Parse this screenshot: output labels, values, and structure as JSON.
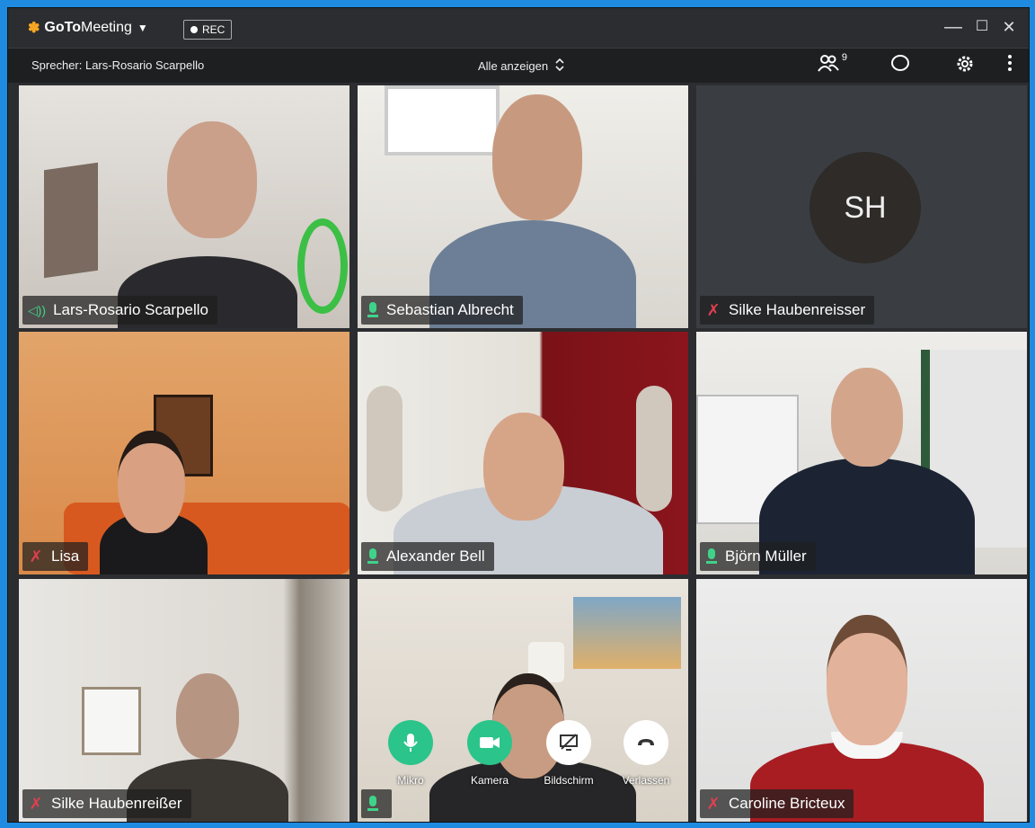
{
  "app": {
    "logo_mark": "✽",
    "logo_bold": "GoTo",
    "logo_light": "Meeting",
    "logo_caret": "▼",
    "rec_label": "REC"
  },
  "window_controls": {
    "minimize": "—",
    "maximize": "☐",
    "close": "✕"
  },
  "infobar": {
    "speaker": "Sprecher: Lars-Rosario Scarpello",
    "view_mode": "Alle anzeigen",
    "view_mode_icon": "⌃⌄",
    "participants_count": "9",
    "icons": {
      "participants": "people-icon",
      "chat": "chat-icon",
      "settings": "gear-icon",
      "more": "more-vertical-icon"
    }
  },
  "tiles": [
    {
      "name": "Lars-Rosario Scarpello",
      "audio": "speaking",
      "video": true,
      "active": true
    },
    {
      "name": "Sebastian Albrecht",
      "audio": "on",
      "video": true
    },
    {
      "name": "Silke Haubenreisser",
      "audio": "muted",
      "video": false,
      "initials": "SH"
    },
    {
      "name": "Lisa",
      "audio": "muted",
      "video": true
    },
    {
      "name": "Alexander Bell",
      "audio": "on",
      "video": true
    },
    {
      "name": "Björn Müller",
      "audio": "on",
      "video": true
    },
    {
      "name": "Silke Haubenreißer",
      "audio": "muted",
      "video": true
    },
    {
      "name": "",
      "audio": "on",
      "video": true
    },
    {
      "name": "Caroline Bricteux",
      "audio": "muted",
      "video": true
    }
  ],
  "controls": [
    {
      "label": "Mikro",
      "icon": "microphone-icon",
      "style": "green"
    },
    {
      "label": "Kamera",
      "icon": "camera-icon",
      "style": "green"
    },
    {
      "label": "Bildschirm",
      "icon": "screen-share-off-icon",
      "style": "white"
    },
    {
      "label": "Verlassen",
      "icon": "hang-up-icon",
      "style": "white"
    }
  ],
  "colors": {
    "accent_green": "#2bc48b",
    "muted_red": "#e0404f",
    "titlebar": "#2b2d30",
    "logo_orange": "#f5a623"
  }
}
